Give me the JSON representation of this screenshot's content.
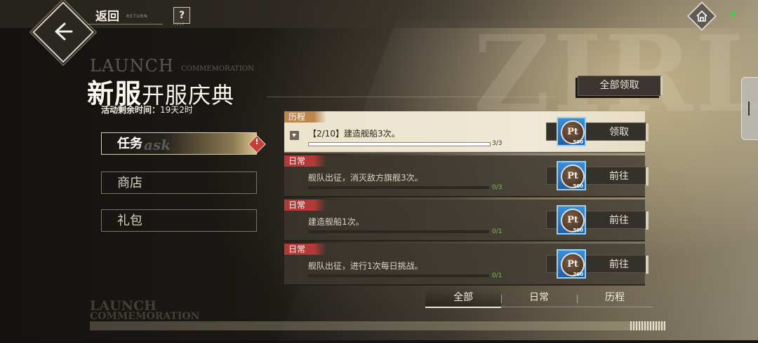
{
  "topbar": {
    "back_label": "返回",
    "back_sub": "RETURN",
    "help_label": "?",
    "help_sub": "HELP"
  },
  "event": {
    "bg_en_1": "LAUNCH",
    "bg_en_2": "COMMEMORATION",
    "title_main": "新服",
    "title_sub": "开服庆典",
    "timer_label": "活动剩余时间：",
    "timer_value": "19天2时"
  },
  "menu": {
    "task": "任务",
    "task_en": "ask",
    "shop": "商店",
    "pack": "礼包",
    "alert_mark": "!"
  },
  "claim_all_label": "全部领取",
  "tasks": [
    {
      "tag": "历程",
      "desc": "【2/10】建造舰船3次。",
      "progress": "3/3",
      "progress_fraction": 1.0,
      "button": "领取",
      "reward_icon": "Pt",
      "reward_qty": "500"
    },
    {
      "tag": "日常",
      "desc": "舰队出征，消灭敌方旗舰3次。",
      "progress": "0/3",
      "progress_fraction": 0,
      "button": "前往",
      "reward_icon": "Pt",
      "reward_qty": "500"
    },
    {
      "tag": "日常",
      "desc": "建造舰船1次。",
      "progress": "0/1",
      "progress_fraction": 0,
      "button": "前往",
      "reward_icon": "Pt",
      "reward_qty": "500"
    },
    {
      "tag": "日常",
      "desc": "舰队出征，进行1次每日挑战。",
      "progress": "0/1",
      "progress_fraction": 0,
      "button": "前往",
      "reward_icon": "Pt",
      "reward_qty": "200"
    }
  ],
  "filters": [
    "全部",
    "日常",
    "历程"
  ],
  "footer": {
    "line1": "LAUNCH",
    "line2": "COMMEMORATION"
  },
  "colors": {
    "daily_tag": "#b33a36",
    "history_tag": "#b9874e",
    "progress_text": "#7bbf49",
    "status_dot": "#39d14a"
  }
}
